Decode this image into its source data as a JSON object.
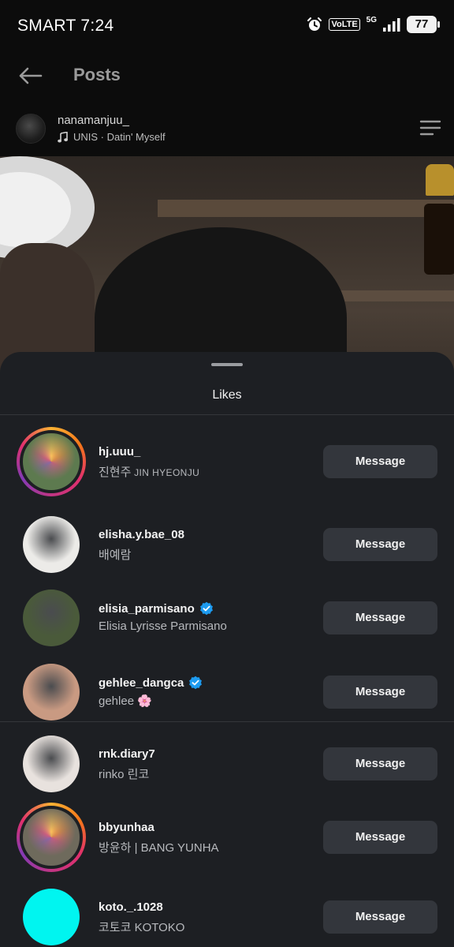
{
  "status_bar": {
    "carrier": "SMART",
    "time": "7:24",
    "volte": "VoLTE",
    "network": "5G",
    "battery": "77"
  },
  "header": {
    "title": "Posts"
  },
  "post": {
    "author": "nanamanjuu_",
    "audio": "UNIS · Datin' Myself"
  },
  "likes_sheet": {
    "title": "Likes",
    "message_label": "Message",
    "users": [
      {
        "username": "hj.uuu_",
        "fullname": "진현주",
        "fullname_suffix": "JIN HYEONJU",
        "verified": false,
        "story": true,
        "avatar_color": "#5d7a4f"
      },
      {
        "username": "elisha.y.bae_08",
        "fullname": "배예람",
        "fullname_suffix": "",
        "verified": false,
        "story": false,
        "avatar_color": "#ecebe8"
      },
      {
        "username": "elisia_parmisano",
        "fullname": "Elisia Lyrisse Parmisano",
        "fullname_suffix": "",
        "verified": true,
        "story": false,
        "avatar_color": "#4a5a3a"
      },
      {
        "username": "gehlee_dangca",
        "fullname": "gehlee 🌸",
        "fullname_suffix": "",
        "verified": true,
        "story": false,
        "avatar_color": "#c99a82"
      },
      {
        "username": "rnk.diary7",
        "fullname": "rinko 린코",
        "fullname_suffix": "",
        "verified": false,
        "story": false,
        "avatar_color": "#e8e2de"
      },
      {
        "username": "bbyunhaa",
        "fullname": "방윤하 | BANG YUNHA",
        "fullname_suffix": "",
        "verified": false,
        "story": true,
        "avatar_color": "#6e6a5c"
      },
      {
        "username": "koto._.1028",
        "fullname": "코토코 KOTOKO",
        "fullname_suffix": "",
        "verified": false,
        "story": false,
        "avatar_color": "#00f5f0"
      }
    ]
  },
  "colors": {
    "sheet_bg": "#1d1f23",
    "button_bg": "#33363c",
    "verified_blue": "#1d9bf0"
  }
}
